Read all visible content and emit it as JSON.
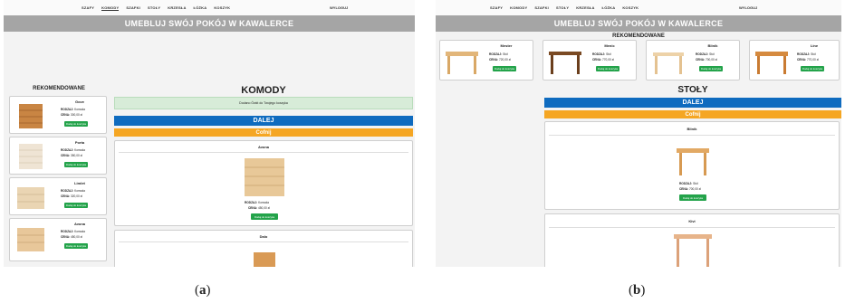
{
  "panel_a": {
    "nav": [
      "SZAFY",
      "KOMODY",
      "SZAFKI",
      "STOŁY",
      "KRZESŁA",
      "ŁÓŻKA",
      "KOSZYK"
    ],
    "logout": "WYLOGUJ",
    "banner": "UMEBLUJ SWÓJ POKÓJ W KAWALERCE",
    "sidebar_title": "REKOMENDOWANE",
    "recommended": [
      {
        "name": "Gove",
        "type_label": "RODZAJ:",
        "type": "Komoda",
        "price_label": "CENA:",
        "price": "300,00 zł",
        "button": "Dodaj do koszyka"
      },
      {
        "name": "Porta",
        "type_label": "RODZAJ:",
        "type": "Komoda",
        "price_label": "CENA:",
        "price": "350,00 zł",
        "button": "Dodaj do koszyka"
      },
      {
        "name": "Limlet",
        "type_label": "RODZAJ:",
        "type": "Komoda",
        "price_label": "CENA:",
        "price": "320,00 zł",
        "button": "Dodaj do koszyka"
      },
      {
        "name": "Avona",
        "type_label": "RODZAJ:",
        "type": "Komoda",
        "price_label": "CENA:",
        "price": "450,00 zł",
        "button": "Dodaj do koszyka"
      }
    ],
    "page_title": "KOMODY",
    "info": "Dodano Ówkt do Twojego koszyka",
    "next": "DALEJ",
    "back": "Cofnij",
    "products": [
      {
        "name": "Avona",
        "type_label": "RODZAJ:",
        "type": "Komoda",
        "price_label": "CENA:",
        "price": "450,00 zł",
        "button": "Dodaj do koszyka"
      },
      {
        "name": "Dalo"
      }
    ]
  },
  "panel_b": {
    "nav": [
      "SZAFY",
      "KOMODY",
      "SZAFKI",
      "STOŁY",
      "KRZESŁA",
      "ŁÓŻKA",
      "KOSZYK"
    ],
    "logout": "WYLOGUJ",
    "banner": "UMEBLUJ SWÓJ POKÓJ W KAWALERCE",
    "rec_title": "REKOMENDOWANE",
    "recommended": [
      {
        "name": "Mester",
        "type_label": "RODZAJ:",
        "type": "Stół",
        "price_label": "CENA:",
        "price": "720,00 zł",
        "button": "Dodaj do koszyka"
      },
      {
        "name": "Menic",
        "type_label": "RODZAJ:",
        "type": "Stół",
        "price_label": "CENA:",
        "price": "770,00 zł",
        "button": "Dodaj do koszyka"
      },
      {
        "name": "Blinik",
        "type_label": "RODZAJ:",
        "type": "Stół",
        "price_label": "CENA:",
        "price": "700,00 zł",
        "button": "Dodaj do koszyka"
      },
      {
        "name": "Line",
        "type_label": "RODZAJ:",
        "type": "Stół",
        "price_label": "CENA:",
        "price": "770,00 zł",
        "button": "Dodaj do koszyka"
      }
    ],
    "page_title": "STOŁY",
    "next": "DALEJ",
    "back": "Cofnij",
    "products": [
      {
        "name": "Blinik",
        "type_label": "RODZAJ:",
        "type": "Stół",
        "price_label": "CENA:",
        "price": "700,00 zł",
        "button": "Dodaj do koszyka"
      },
      {
        "name": "Kivi"
      }
    ]
  },
  "captions": {
    "a": "a",
    "b": "b"
  },
  "colors": {
    "banner": "#a5a5a5",
    "next_bar": "#0f6bbf",
    "back_bar": "#f5a623",
    "add_button": "#23a34a",
    "info_box": "#d7ecd8"
  }
}
